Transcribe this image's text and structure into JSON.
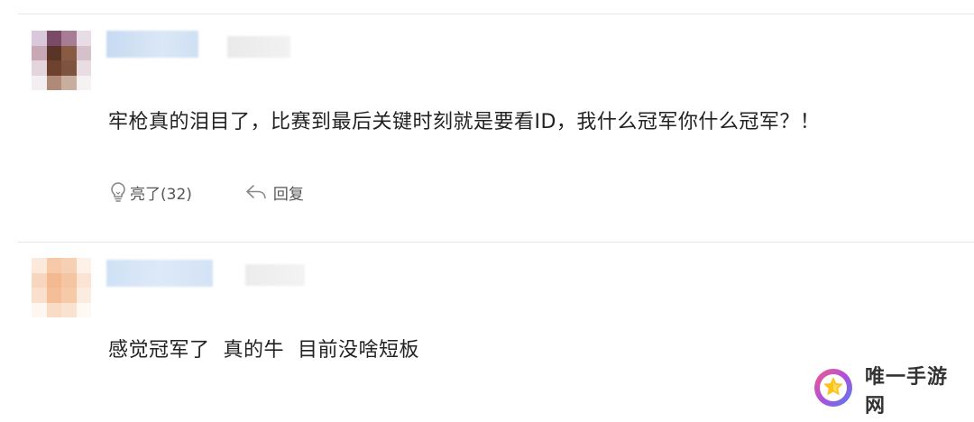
{
  "comments": [
    {
      "text": "牢枪真的泪目了，比赛到最后关键时刻就是要看ID，我什么冠军你什么冠军？！",
      "like_label": "亮了(32)",
      "reply_label": "回复",
      "like_icon": "lightbulb-icon",
      "reply_icon": "reply-arrow-icon"
    },
    {
      "text": "感觉冠军了  真的牛  目前没啥短板"
    }
  ],
  "watermark": {
    "text": "唯一手游网",
    "logo_icon": "star-logo-icon"
  },
  "colors": {
    "divider": "#e6e6e6",
    "text": "#222222",
    "action_text": "#555555"
  }
}
